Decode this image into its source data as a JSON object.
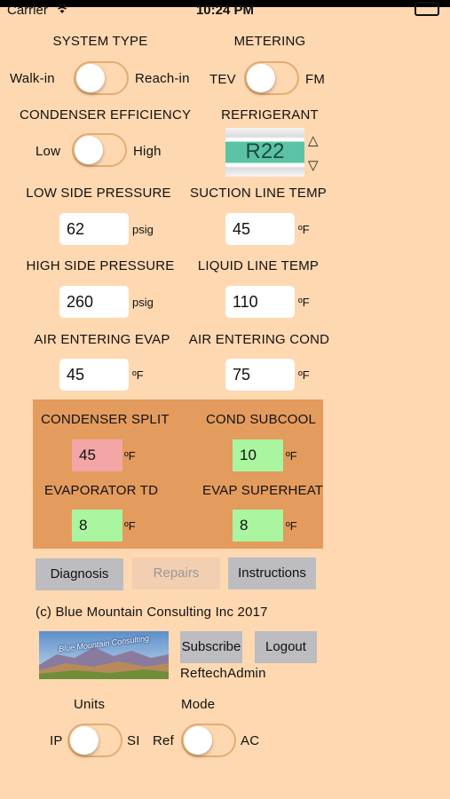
{
  "status_bar": {
    "carrier": "Carrier",
    "time": "10:24 PM"
  },
  "system_type": {
    "label": "SYSTEM TYPE",
    "left": "Walk-in",
    "right": "Reach-in",
    "on": false
  },
  "metering": {
    "label": "METERING",
    "left": "TEV",
    "right": "FM",
    "on": false
  },
  "condenser_efficiency": {
    "label": "CONDENSER EFFICIENCY",
    "left": "Low",
    "right": "High",
    "on": false
  },
  "refrigerant": {
    "label": "REFRIGERANT",
    "value": "R22",
    "up_arrow": "△",
    "down_arrow": "▽"
  },
  "inputs": {
    "low_side_pressure": {
      "label": "LOW SIDE PRESSURE",
      "value": "62",
      "unit": "psig"
    },
    "suction_line_temp": {
      "label": "SUCTION LINE TEMP",
      "value": "45",
      "unit": "ºF"
    },
    "high_side_pressure": {
      "label": "HIGH SIDE PRESSURE",
      "value": "260",
      "unit": "psig"
    },
    "liquid_line_temp": {
      "label": "LIQUID LINE TEMP",
      "value": "110",
      "unit": "ºF"
    },
    "air_entering_evap": {
      "label": "AIR ENTERING EVAP",
      "value": "45",
      "unit": "ºF"
    },
    "air_entering_cond": {
      "label": "AIR ENTERING COND",
      "value": "75",
      "unit": "ºF"
    }
  },
  "results": {
    "condenser_split": {
      "label": "CONDENSER SPLIT",
      "value": "45",
      "unit": "ºF",
      "color": "#f4a6a6"
    },
    "cond_subcool": {
      "label": "COND SUBCOOL",
      "value": "10",
      "unit": "ºF",
      "color": "#a9f5a0"
    },
    "evaporator_td": {
      "label": "EVAPORATOR TD",
      "value": "8",
      "unit": "ºF",
      "color": "#a9f5a0"
    },
    "evap_superheat": {
      "label": "EVAP SUPERHEAT",
      "value": "8",
      "unit": "ºF",
      "color": "#a9f5a0"
    }
  },
  "buttons": {
    "diagnosis": "Diagnosis",
    "repairs": "Repairs",
    "instructions": "Instructions",
    "subscribe": "Subscribe",
    "logout": "Logout"
  },
  "copyright": "(c) Blue Mountain Consulting Inc 2017",
  "logo_text": "Blue Mountain Consulting",
  "username": "ReftechAdmin",
  "units": {
    "label": "Units",
    "left": "IP",
    "right": "SI",
    "on": false
  },
  "mode": {
    "label": "Mode",
    "left": "Ref",
    "right": "AC",
    "on": false
  },
  "colors": {
    "background": "#fed8b1",
    "results_panel": "#e49b5e",
    "button": "#bcbcc1",
    "toggle_border": "#e3ad72",
    "picker_highlight": "#5cc2a6"
  },
  "icons": {
    "wifi": "wifi-icon",
    "battery": "battery-icon",
    "picker_up": "triangle-up-icon",
    "picker_down": "triangle-down-icon"
  }
}
